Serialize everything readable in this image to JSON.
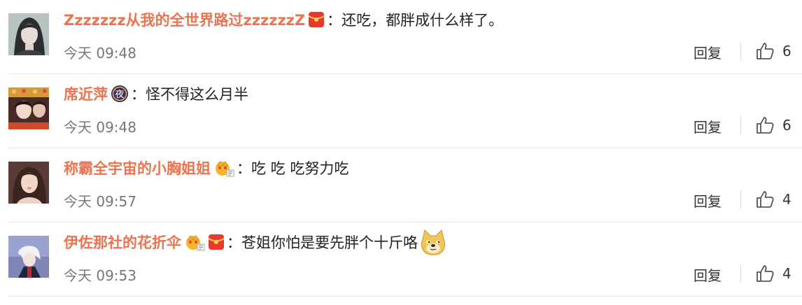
{
  "comments": [
    {
      "username": "Zzzzzzz从我的全世界路过zzzzzzZ",
      "badges": [
        "red-envelope"
      ],
      "colon": "：",
      "text": "还吃，都胖成什么样了。",
      "time": "今天 09:48",
      "reply_label": "回复",
      "likes": "6"
    },
    {
      "username": "席近萍",
      "badges": [
        "night-badge"
      ],
      "colon": "：",
      "text": "怪不得这么月半",
      "time": "今天 09:48",
      "reply_label": "回复",
      "likes": "6"
    },
    {
      "username": "称霸全宇宙的小胸姐姐",
      "badges": [
        "crown-badge"
      ],
      "colon": "：",
      "text": "吃 吃 吃努力吃",
      "time": "今天 09:57",
      "reply_label": "回复",
      "likes": "4"
    },
    {
      "username": "伊佐那社的花折伞",
      "badges": [
        "crown-badge",
        "red-envelope"
      ],
      "colon": "：",
      "text": "苍姐你怕是要先胖个十斤咯",
      "emoji": "doge-emoji",
      "time": "今天 09:53",
      "reply_label": "回复",
      "likes": "4"
    }
  ],
  "colors": {
    "username": "#eb7350",
    "text": "#222222",
    "time": "#777777",
    "divider": "#e6e6e6"
  }
}
